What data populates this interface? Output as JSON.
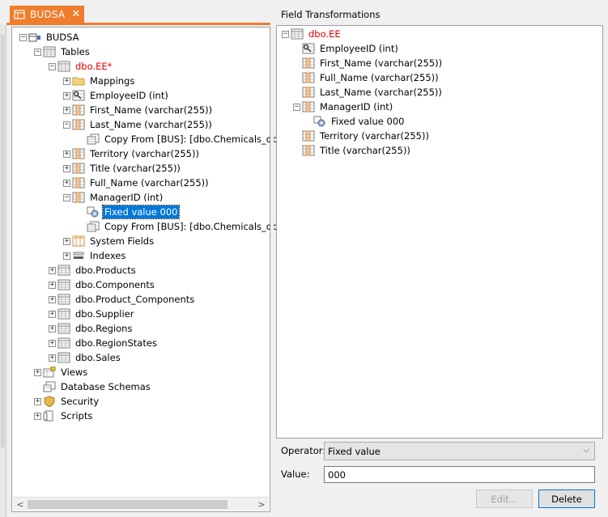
{
  "tab": {
    "label": "BUDSA",
    "close": "✕"
  },
  "tree": [
    {
      "depth": 0,
      "exp": "−",
      "icon": "database-icon",
      "label": "BUDSA"
    },
    {
      "depth": 1,
      "exp": "−",
      "icon": "table-icon",
      "label": "Tables"
    },
    {
      "depth": 2,
      "exp": "−",
      "icon": "table-icon",
      "label": "dbo.EE*",
      "red": true
    },
    {
      "depth": 3,
      "exp": "+",
      "icon": "folder-icon",
      "label": "Mappings"
    },
    {
      "depth": 3,
      "exp": "+",
      "icon": "key-column-icon",
      "label": "EmployeeID (int)"
    },
    {
      "depth": 3,
      "exp": "+",
      "icon": "column-icon",
      "label": "First_Name (varchar(255))"
    },
    {
      "depth": 3,
      "exp": "−",
      "icon": "column-icon",
      "label": "Last_Name (varchar(255))"
    },
    {
      "depth": 4,
      "exp": "",
      "icon": "copy-icon",
      "label": "Copy From [BUS]: [dbo.Chemicals_dbo_E"
    },
    {
      "depth": 3,
      "exp": "+",
      "icon": "column-icon",
      "label": "Territory (varchar(255))"
    },
    {
      "depth": 3,
      "exp": "+",
      "icon": "column-icon",
      "label": "Title (varchar(255))"
    },
    {
      "depth": 3,
      "exp": "+",
      "icon": "column-icon",
      "label": "Full_Name (varchar(255))"
    },
    {
      "depth": 3,
      "exp": "−",
      "icon": "column-icon",
      "label": "ManagerID (int)"
    },
    {
      "depth": 4,
      "exp": "",
      "icon": "gear-icon",
      "label": "Fixed value 000",
      "selected": true
    },
    {
      "depth": 4,
      "exp": "",
      "icon": "copy-icon",
      "label": "Copy From [BUS]: [dbo.Chemicals_dbo_E"
    },
    {
      "depth": 3,
      "exp": "+",
      "icon": "system-fields-icon",
      "label": "System Fields"
    },
    {
      "depth": 3,
      "exp": "+",
      "icon": "index-icon",
      "label": "Indexes"
    },
    {
      "depth": 2,
      "exp": "+",
      "icon": "table-icon",
      "label": "dbo.Products"
    },
    {
      "depth": 2,
      "exp": "+",
      "icon": "table-icon",
      "label": "dbo.Components"
    },
    {
      "depth": 2,
      "exp": "+",
      "icon": "table-icon",
      "label": "dbo.Product_Components"
    },
    {
      "depth": 2,
      "exp": "+",
      "icon": "table-icon",
      "label": "dbo.Supplier"
    },
    {
      "depth": 2,
      "exp": "+",
      "icon": "table-icon",
      "label": "dbo.Regions"
    },
    {
      "depth": 2,
      "exp": "+",
      "icon": "table-icon",
      "label": "dbo.RegionStates"
    },
    {
      "depth": 2,
      "exp": "+",
      "icon": "table-icon",
      "label": "dbo.Sales"
    },
    {
      "depth": 1,
      "exp": "+",
      "icon": "view-icon",
      "label": "Views"
    },
    {
      "depth": 1,
      "exp": "",
      "icon": "schema-icon",
      "label": "Database Schemas"
    },
    {
      "depth": 1,
      "exp": "+",
      "icon": "shield-icon",
      "label": "Security"
    },
    {
      "depth": 1,
      "exp": "+",
      "icon": "script-icon",
      "label": "Scripts"
    }
  ],
  "field_transformations": {
    "title": "Field Transformations",
    "tree": [
      {
        "depth": 0,
        "exp": "−",
        "icon": "table-icon",
        "label": "dbo.EE",
        "red": true
      },
      {
        "depth": 1,
        "exp": "",
        "icon": "key-column-icon",
        "label": "EmployeeID (int)"
      },
      {
        "depth": 1,
        "exp": "",
        "icon": "column-icon",
        "label": "First_Name (varchar(255))"
      },
      {
        "depth": 1,
        "exp": "",
        "icon": "column-icon",
        "label": "Full_Name (varchar(255))"
      },
      {
        "depth": 1,
        "exp": "",
        "icon": "column-icon",
        "label": "Last_Name (varchar(255))"
      },
      {
        "depth": 1,
        "exp": "−",
        "icon": "column-icon",
        "label": "ManagerID (int)"
      },
      {
        "depth": 2,
        "exp": "",
        "icon": "gear-icon",
        "label": "Fixed value 000"
      },
      {
        "depth": 1,
        "exp": "",
        "icon": "column-icon",
        "label": "Territory (varchar(255))"
      },
      {
        "depth": 1,
        "exp": "",
        "icon": "column-icon",
        "label": "Title (varchar(255))"
      }
    ],
    "operator_label": "Operator:",
    "operator_value": "Fixed value",
    "value_label": "Value:",
    "value": "000",
    "edit_label": "Edit...",
    "delete_label": "Delete"
  }
}
